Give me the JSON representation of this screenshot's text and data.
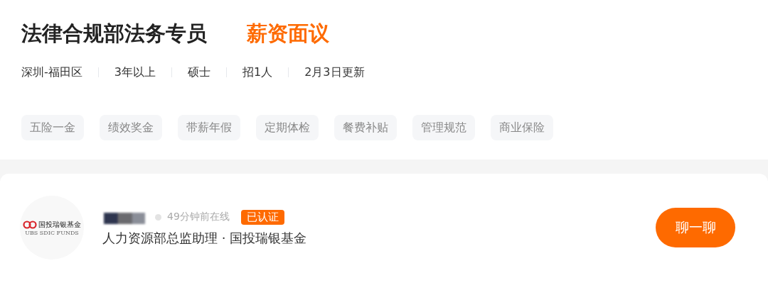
{
  "job": {
    "title": "法律合规部法务专员",
    "salary": "薪资面议",
    "meta": [
      "深圳-福田区",
      "3年以上",
      "硕士",
      "招1人",
      "2月3日更新"
    ],
    "tags": [
      "五险一金",
      "绩效奖金",
      "带薪年假",
      "定期体检",
      "餐费补贴",
      "管理规范",
      "商业保险"
    ]
  },
  "recruiter": {
    "logo_text": "国投瑞银基金",
    "logo_subtext": "UBS SDIC FUNDS",
    "online": "49分钟前在线",
    "verified": true,
    "verified_label": "已认证",
    "position": "人力资源部总监助理 · 国投瑞银基金",
    "chat_button": "聊一聊"
  }
}
